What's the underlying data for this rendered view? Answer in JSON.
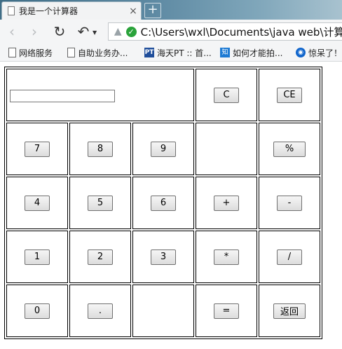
{
  "browser": {
    "tab_title": "我是一个计算器",
    "tab_close": "×",
    "new_tab": "+",
    "address": "C:\\Users\\wxl\\Documents\\java web\\计算器\\",
    "bookmarks": [
      {
        "label": "网络服务",
        "icon": "document-icon",
        "glyph": ""
      },
      {
        "label": "自助业务办...",
        "icon": "document-icon",
        "glyph": ""
      },
      {
        "label": "海天PT :: 首...",
        "icon": "pt-logo-icon",
        "glyph": "PT"
      },
      {
        "label": "如何才能拍...",
        "icon": "zhihu-icon",
        "glyph": "知"
      },
      {
        "label": "惊呆了！",
        "icon": "eye-icon",
        "glyph": "◉"
      }
    ]
  },
  "calculator": {
    "display_value": "",
    "buttons": {
      "clear": "C",
      "clear_entry": "CE",
      "seven": "7",
      "eight": "8",
      "nine": "9",
      "percent": "%",
      "four": "4",
      "five": "5",
      "six": "6",
      "plus": "+",
      "minus": "-",
      "one": "1",
      "two": "2",
      "three": "3",
      "multiply": "*",
      "divide": "/",
      "zero": "0",
      "dot": ".",
      "equals": "=",
      "back": "返回"
    }
  }
}
